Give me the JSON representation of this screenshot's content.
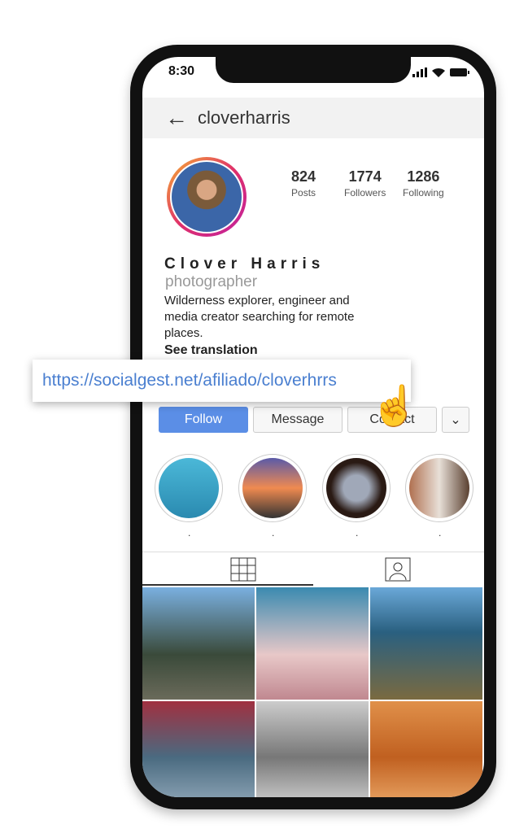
{
  "status": {
    "time": "8:30"
  },
  "header": {
    "username": "cloverharris",
    "back_icon": "arrow-left-icon"
  },
  "profile": {
    "stats": [
      {
        "value": "824",
        "label": "Posts"
      },
      {
        "value": "1774",
        "label": "Followers"
      },
      {
        "value": "1286",
        "label": "Following"
      }
    ],
    "name": "Clover Harris",
    "role": "photographer",
    "bio": "Wilderness explorer, engineer and media creator searching for remote places.",
    "see_translation": "See translation"
  },
  "buttons": {
    "follow": "Follow",
    "message": "Message",
    "contact": "Contact"
  },
  "highlights": [
    {
      "label": "."
    },
    {
      "label": "."
    },
    {
      "label": "."
    },
    {
      "label": "."
    }
  ],
  "link_popup": {
    "url": "https://socialgest.net/afiliado/cloverhrrs"
  },
  "colors": {
    "follow": "#5b8ee6",
    "link": "#4a7fd0"
  }
}
